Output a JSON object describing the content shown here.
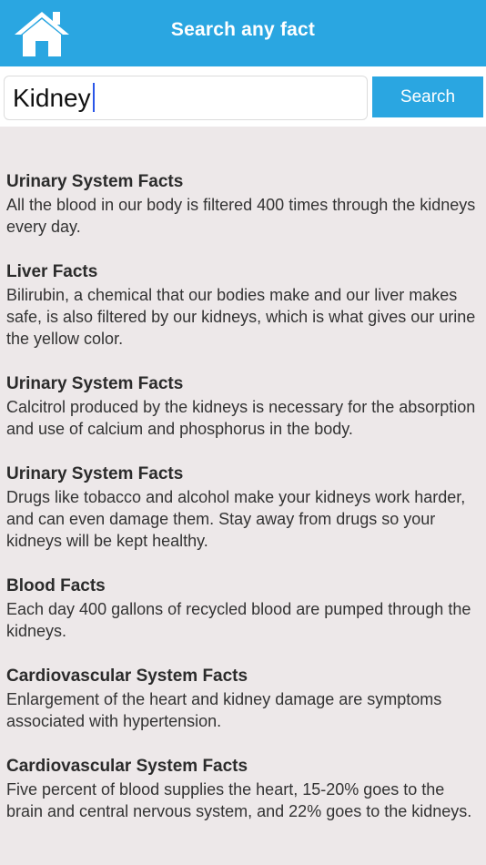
{
  "header": {
    "title": "Search any fact",
    "home_icon": "home-icon"
  },
  "search": {
    "value": "Kidney",
    "button_label": "Search"
  },
  "colors": {
    "accent": "#2aa6e1",
    "background": "#ede8e9",
    "caret": "#2a56e8"
  },
  "results": [
    {
      "title": "Urinary System Facts",
      "text": "All the blood in our body is filtered 400 times through the kidneys every day."
    },
    {
      "title": "Liver Facts",
      "text": "Bilirubin, a chemical that our bodies make and our liver makes safe, is also filtered by our kidneys, which is what gives our urine the yellow color."
    },
    {
      "title": "Urinary System Facts",
      "text": "Calcitrol produced by the kidneys is necessary for the absorption and use of calcium and phosphorus in the body."
    },
    {
      "title": "Urinary System Facts",
      "text": "Drugs like tobacco and alcohol make your kidneys work harder, and can even damage them. Stay away from drugs so your kidneys will be kept healthy."
    },
    {
      "title": "Blood Facts",
      "text": "Each day 400 gallons of recycled blood are pumped through the kidneys."
    },
    {
      "title": "Cardiovascular System Facts",
      "text": "Enlargement of the heart and kidney damage are symptoms associated with hypertension."
    },
    {
      "title": "Cardiovascular System Facts",
      "text": "Five percent of blood supplies the heart, 15-20% goes to the brain and central nervous system, and 22% goes to the kidneys."
    }
  ]
}
